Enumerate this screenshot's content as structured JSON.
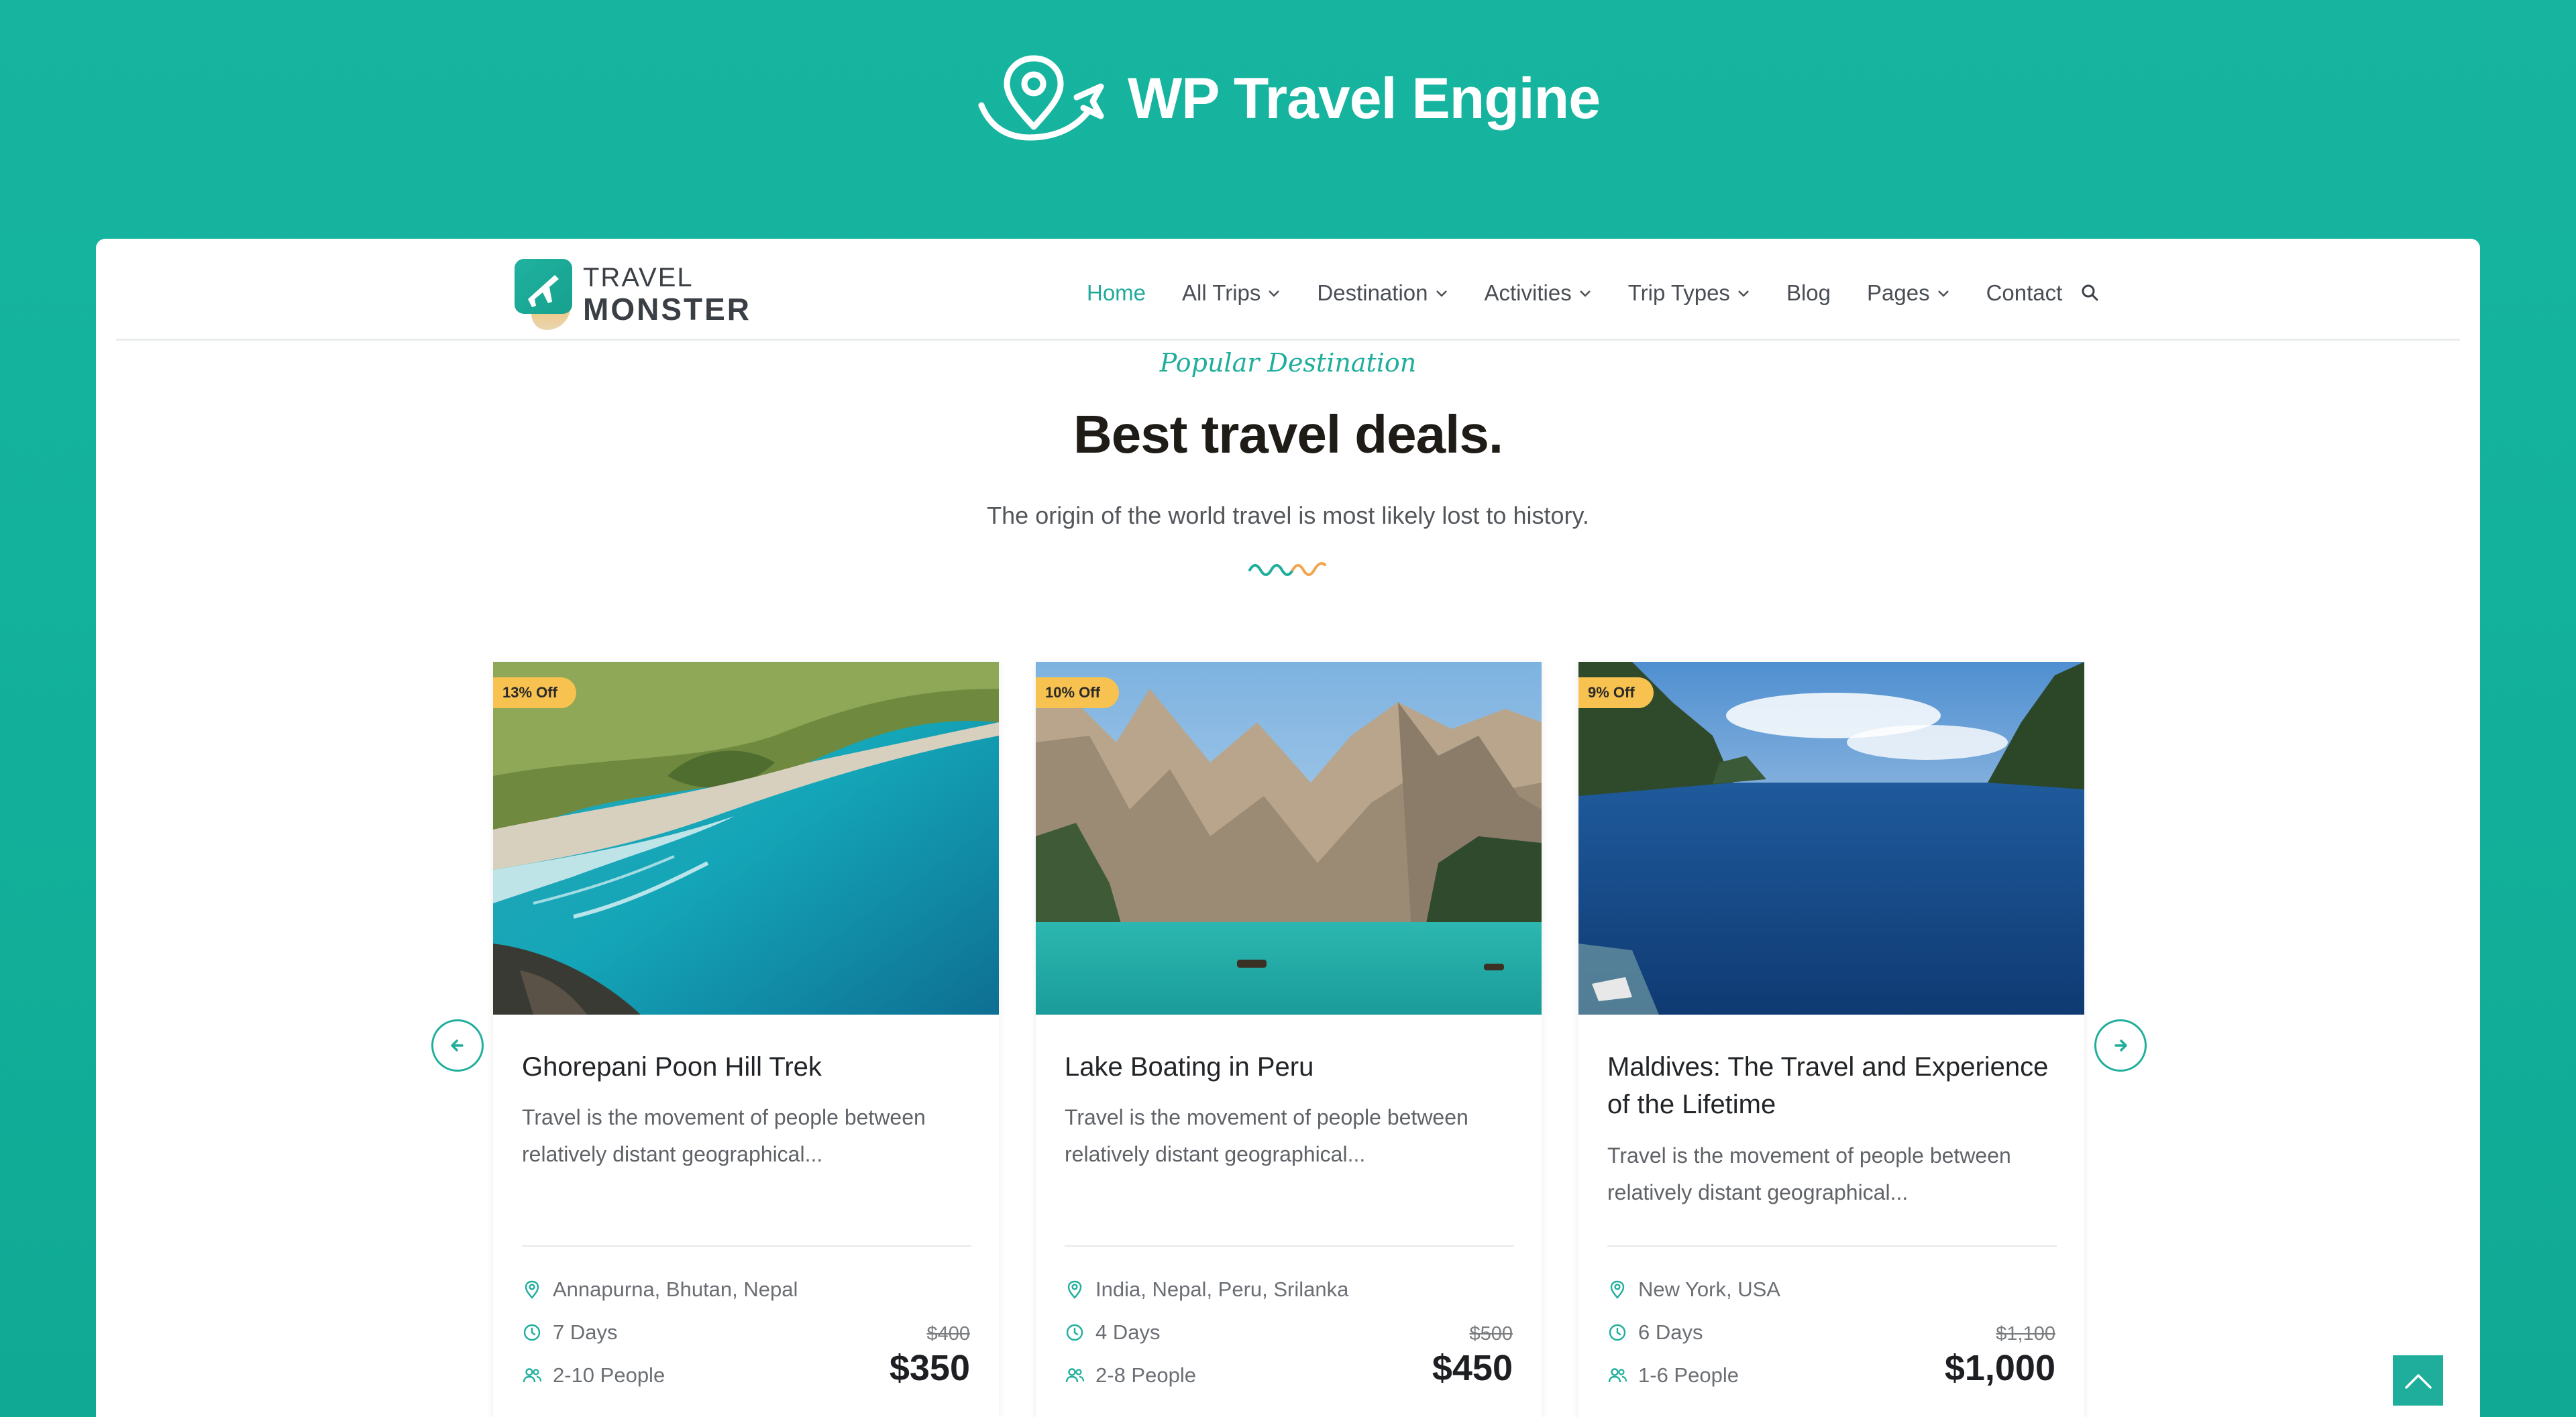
{
  "banner": {
    "title": "WP Travel Engine",
    "icon": "location-plane-icon"
  },
  "site": {
    "logo": {
      "line1": "TRAVEL",
      "line2": "MONSTER"
    },
    "nav": [
      {
        "label": "Home",
        "active": true,
        "dropdown": false
      },
      {
        "label": "All Trips",
        "dropdown": true
      },
      {
        "label": "Destination",
        "dropdown": true
      },
      {
        "label": "Activities",
        "dropdown": true
      },
      {
        "label": "Trip Types",
        "dropdown": true
      },
      {
        "label": "Blog",
        "dropdown": false
      },
      {
        "label": "Pages",
        "dropdown": true
      },
      {
        "label": "Contact",
        "dropdown": false
      }
    ],
    "accent": "#1fae9c"
  },
  "section": {
    "eyebrow": "Popular Destination",
    "headline": "Best travel deals.",
    "subline": "The origin of the world travel is most likely lost to history."
  },
  "cards": [
    {
      "badge": "13% Off",
      "title": "Ghorepani Poon Hill Trek",
      "desc": "Travel is the movement of people between relatively distant geographical...",
      "location": "Annapurna, Bhutan, Nepal",
      "duration": "7 Days",
      "people": "2-10 People",
      "old_price": "$400",
      "price": "$350"
    },
    {
      "badge": "10% Off",
      "title": "Lake Boating in Peru",
      "desc": "Travel is the movement of people between relatively distant geographical...",
      "location": "India, Nepal, Peru, Srilanka",
      "duration": "4 Days",
      "people": "2-8 People",
      "old_price": "$500",
      "price": "$450"
    },
    {
      "badge": "9% Off",
      "title": "Maldives: The Travel and Experience of the Lifetime",
      "desc": "Travel is the movement of people between relatively distant geographical...",
      "location": "New York, USA",
      "duration": "6 Days",
      "people": "1-6 People",
      "old_price": "$1,100",
      "price": "$1,000"
    }
  ]
}
